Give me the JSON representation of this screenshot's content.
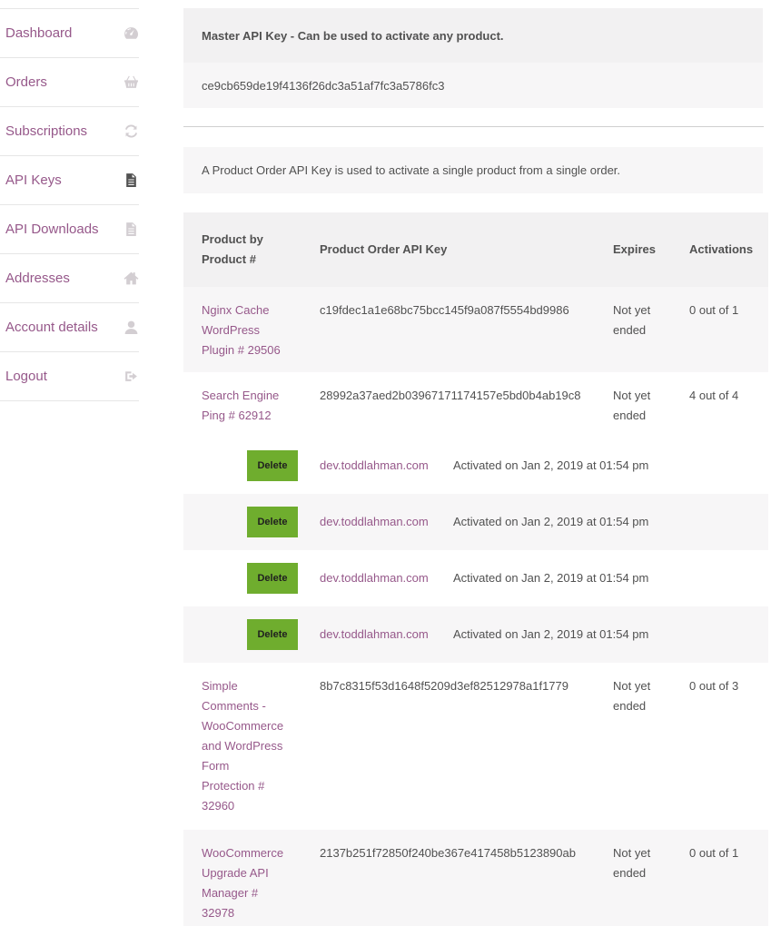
{
  "nav": {
    "items": [
      {
        "label": "Dashboard",
        "icon": "dashboard-icon"
      },
      {
        "label": "Orders",
        "icon": "basket-icon"
      },
      {
        "label": "Subscriptions",
        "icon": "refresh-icon"
      },
      {
        "label": "API Keys",
        "icon": "document-icon",
        "active": true
      },
      {
        "label": "API Downloads",
        "icon": "document-icon"
      },
      {
        "label": "Addresses",
        "icon": "home-icon"
      },
      {
        "label": "Account details",
        "icon": "user-icon"
      },
      {
        "label": "Logout",
        "icon": "logout-icon"
      }
    ]
  },
  "master": {
    "heading": "Master API Key - Can be used to activate any product.",
    "key": "ce9cb659de19f4136f26dc3a51af7fc3a5786fc3"
  },
  "info": "A Product Order API Key is used to activate a single product from a single order.",
  "table": {
    "headers": {
      "product": [
        "Product by",
        "Product #"
      ],
      "key": "Product Order API Key",
      "expires": "Expires",
      "activations": "Activations"
    },
    "rows": [
      {
        "product": [
          "Nginx Cache",
          "WordPress",
          "Plugin # 29506"
        ],
        "key": "c19fdec1a1e68bc75bcc145f9a087f5554bd9986",
        "expires": [
          "Not yet",
          "ended"
        ],
        "activations": "0 out of 1"
      },
      {
        "product": [
          "Search Engine",
          "Ping # 62912"
        ],
        "key": "28992a37aed2b03967171174157e5bd0b4ab19c8",
        "expires": [
          "Not yet",
          "ended"
        ],
        "activations": "4 out of 4"
      },
      {
        "product": [
          "Simple",
          "Comments -",
          "WooCommerce",
          "and WordPress",
          "Form",
          "Protection #",
          "32960"
        ],
        "key": "8b7c8315f53d1648f5209d3ef82512978a1f1779",
        "expires": [
          "Not yet",
          "ended"
        ],
        "activations": "0 out of 3"
      },
      {
        "product": [
          "WooCommerce",
          "Upgrade API",
          "Manager #",
          "32978"
        ],
        "key": "2137b251f72850f240be367e417458b5123890ab",
        "expires": [
          "Not yet",
          "ended"
        ],
        "activations": "0 out of 1"
      }
    ],
    "activations": [
      {
        "button": "Delete",
        "domain": "dev.toddlahman.com",
        "when": "Activated on Jan 2, 2019 at 01:54 pm"
      },
      {
        "button": "Delete",
        "domain": "dev.toddlahman.com",
        "when": "Activated on Jan 2, 2019 at 01:54 pm"
      },
      {
        "button": "Delete",
        "domain": "dev.toddlahman.com",
        "when": "Activated on Jan 2, 2019 at 01:54 pm"
      },
      {
        "button": "Delete",
        "domain": "dev.toddlahman.com",
        "when": "Activated on Jan 2, 2019 at 01:54 pm"
      }
    ]
  },
  "colors": {
    "link": "#96588a",
    "text": "#515151",
    "delete_button": "#6fad2e",
    "panel": "#f7f6f7"
  }
}
